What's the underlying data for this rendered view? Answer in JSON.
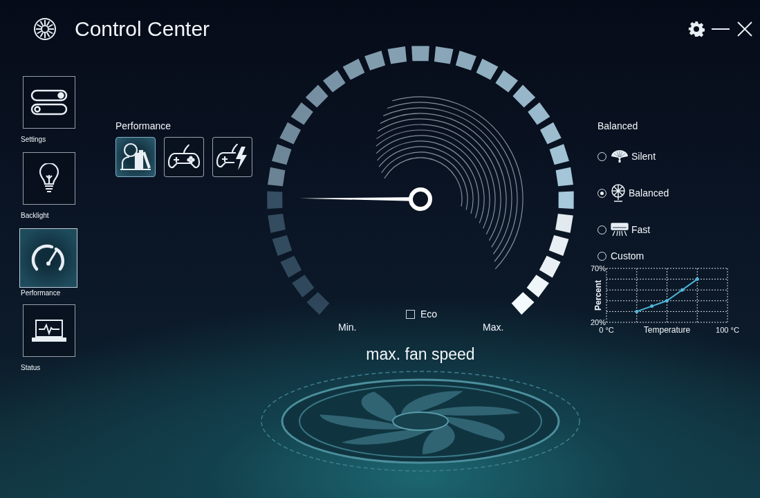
{
  "window": {
    "title": "Control Center"
  },
  "sidebar": {
    "items": [
      {
        "kind": "settings",
        "label": "Settings",
        "selected": false
      },
      {
        "kind": "backlight",
        "label": "Backlight",
        "selected": false
      },
      {
        "kind": "performance",
        "label": "Performance",
        "selected": true
      },
      {
        "kind": "status",
        "label": "Status",
        "selected": false
      }
    ]
  },
  "performance": {
    "title": "Performance",
    "modes": [
      {
        "kind": "office",
        "selected": true
      },
      {
        "kind": "gaming",
        "selected": false
      },
      {
        "kind": "turbo",
        "selected": false
      }
    ]
  },
  "gauge": {
    "level": 0.18,
    "min_label": "Min.",
    "max_label": "Max.",
    "eco": {
      "label": "Eco",
      "checked": false
    },
    "caption": "max. fan speed"
  },
  "fan_mode": {
    "title": "Balanced",
    "options": [
      {
        "kind": "silent",
        "label": "Silent",
        "selected": false
      },
      {
        "kind": "balanced",
        "label": "Balanced",
        "selected": true
      },
      {
        "kind": "fast",
        "label": "Fast",
        "selected": false
      },
      {
        "kind": "custom",
        "label": "Custom",
        "selected": false
      }
    ],
    "chart_data": {
      "type": "line",
      "xlabel": "Temperature",
      "ylabel": "Percent",
      "x": [
        25,
        37.5,
        50,
        62.5,
        75
      ],
      "series": [
        {
          "color": "#4fb8dc",
          "values": [
            30,
            35,
            40,
            50,
            60
          ]
        }
      ],
      "xlim": [
        0,
        100
      ],
      "ylim": [
        20,
        70
      ],
      "xticks": [
        {
          "value": 0,
          "label": "0 °C"
        },
        {
          "value": 100,
          "label": "100 °C"
        }
      ],
      "yticks": [
        {
          "value": 20,
          "label": "20%"
        },
        {
          "value": 70,
          "label": "70%"
        }
      ]
    }
  }
}
